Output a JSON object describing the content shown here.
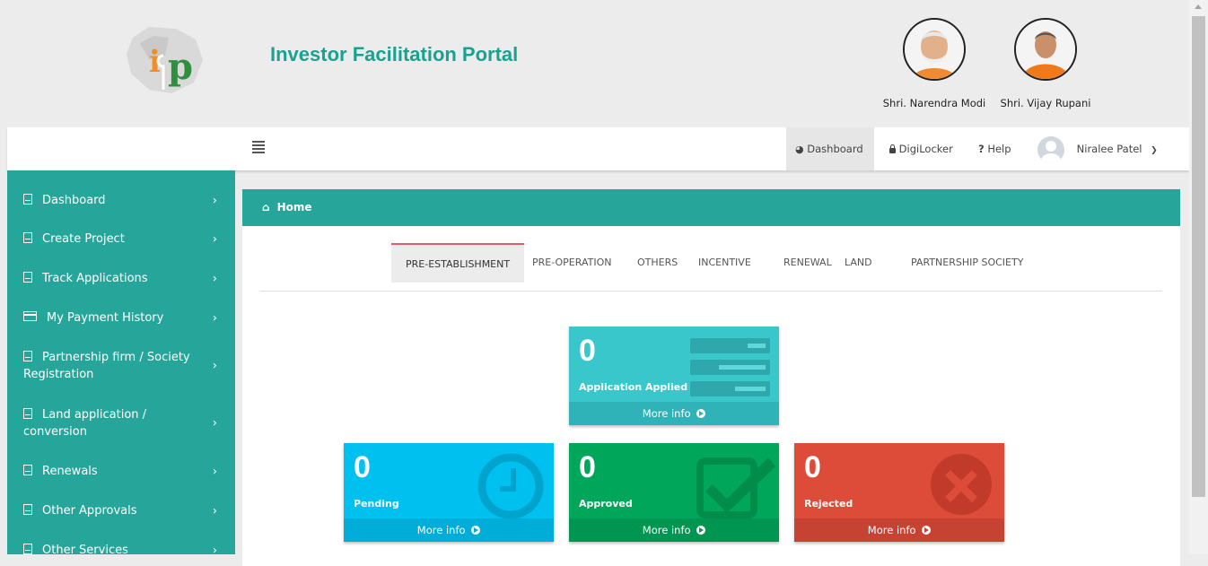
{
  "header": {
    "title": "Investor Facilitation Portal",
    "leaders": [
      {
        "name": "Shri. Narendra Modi"
      },
      {
        "name": "Shri. Vijay Rupani"
      }
    ]
  },
  "topbar": {
    "dashboard": "Dashboard",
    "digilocker": "DigiLocker",
    "help": "Help",
    "user_name": "Niralee Patel"
  },
  "sidebar": {
    "items": [
      {
        "label": "Dashboard"
      },
      {
        "label": "Create Project"
      },
      {
        "label": "Track Applications"
      },
      {
        "label": "My Payment History"
      },
      {
        "label": "Partnership firm / Society Registration"
      },
      {
        "label": "Land application / conversion"
      },
      {
        "label": "Renewals"
      },
      {
        "label": "Other Approvals"
      },
      {
        "label": "Other Services"
      }
    ]
  },
  "breadcrumb": {
    "home": "Home"
  },
  "tabs": [
    "PRE-ESTABLISHMENT",
    "PRE-OPERATION",
    "OTHERS",
    "INCENTIVE",
    "RENEWAL",
    "LAND",
    "PARTNERSHIP SOCIETY"
  ],
  "boxes": {
    "applied": {
      "count": "0",
      "label": "Application Applied",
      "more": "More info",
      "color": "#39c7cc"
    },
    "pending": {
      "count": "0",
      "label": "Pending",
      "more": "More info",
      "color": "#00c0ef"
    },
    "approved": {
      "count": "0",
      "label": "Approved",
      "more": "More info",
      "color": "#00a65a"
    },
    "rejected": {
      "count": "0",
      "label": "Rejected",
      "more": "More info",
      "color": "#dd4b39"
    }
  },
  "colors": {
    "accent": "#26a69a",
    "title": "#1aa190"
  }
}
